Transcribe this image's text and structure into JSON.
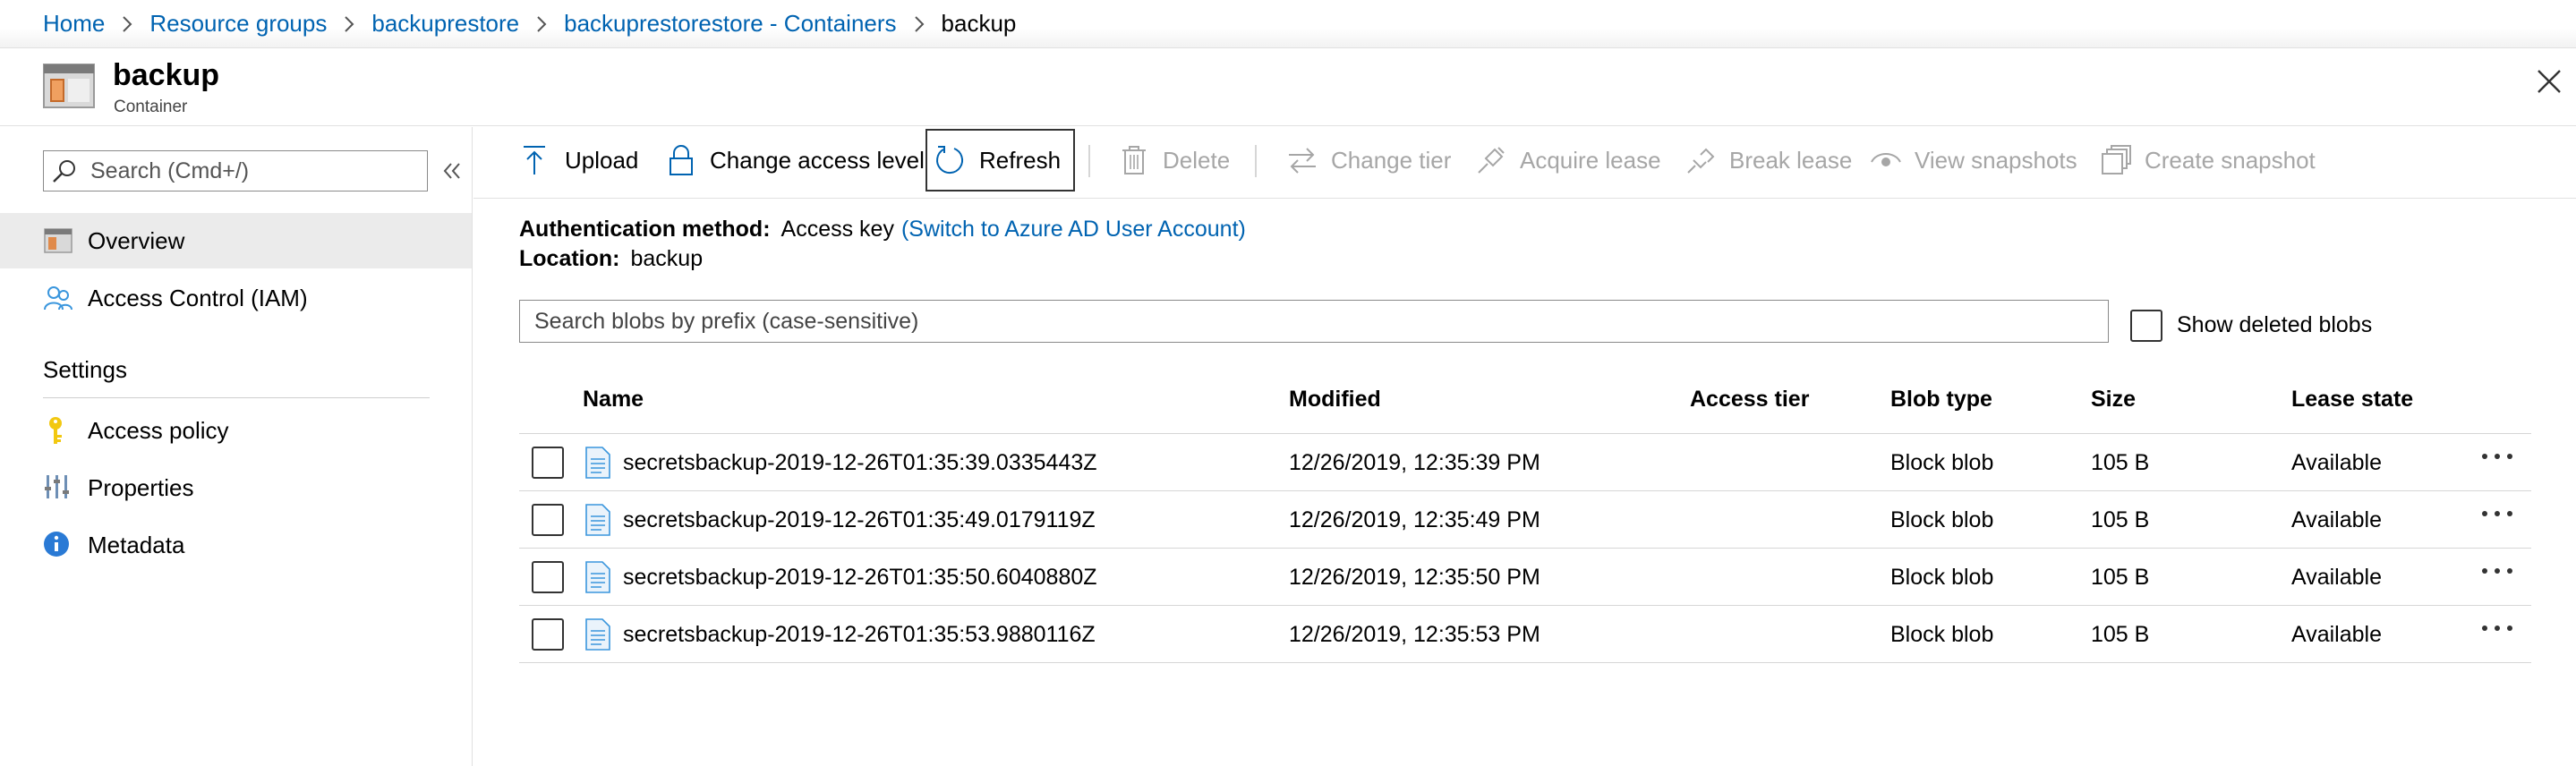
{
  "breadcrumb": [
    {
      "label": "Home"
    },
    {
      "label": "Resource groups"
    },
    {
      "label": "backuprestore"
    },
    {
      "label": "backuprestorestore - Containers"
    },
    {
      "label": "backup"
    }
  ],
  "header": {
    "title": "backup",
    "subtitle": "Container"
  },
  "sidebar": {
    "search_placeholder": "Search (Cmd+/)",
    "items": [
      {
        "label": "Overview",
        "icon": "container-icon",
        "active": true
      },
      {
        "label": "Access Control (IAM)",
        "icon": "people-icon"
      }
    ],
    "settings_heading": "Settings",
    "settings_items": [
      {
        "label": "Access policy",
        "icon": "key-icon"
      },
      {
        "label": "Properties",
        "icon": "properties-icon"
      },
      {
        "label": "Metadata",
        "icon": "info-icon"
      }
    ]
  },
  "toolbar": {
    "upload": "Upload",
    "change_access": "Change access level",
    "refresh": "Refresh",
    "delete": "Delete",
    "change_tier": "Change tier",
    "acquire_lease": "Acquire lease",
    "break_lease": "Break lease",
    "view_snapshots": "View snapshots",
    "create_snapshot": "Create snapshot"
  },
  "info": {
    "auth_label": "Authentication method:",
    "auth_value": "Access key",
    "auth_link": "(Switch to Azure AD User Account)",
    "location_label": "Location:",
    "location_value": "backup"
  },
  "blob_search": {
    "placeholder": "Search blobs by prefix (case-sensitive)"
  },
  "show_deleted_label": "Show deleted blobs",
  "table": {
    "columns": [
      "Name",
      "Modified",
      "Access tier",
      "Blob type",
      "Size",
      "Lease state"
    ],
    "rows": [
      {
        "name": "secretsbackup-2019-12-26T01:35:39.0335443Z",
        "modified": "12/26/2019, 12:35:39 PM",
        "access_tier": "",
        "blob_type": "Block blob",
        "size": "105 B",
        "lease_state": "Available"
      },
      {
        "name": "secretsbackup-2019-12-26T01:35:49.0179119Z",
        "modified": "12/26/2019, 12:35:49 PM",
        "access_tier": "",
        "blob_type": "Block blob",
        "size": "105 B",
        "lease_state": "Available"
      },
      {
        "name": "secretsbackup-2019-12-26T01:35:50.6040880Z",
        "modified": "12/26/2019, 12:35:50 PM",
        "access_tier": "",
        "blob_type": "Block blob",
        "size": "105 B",
        "lease_state": "Available"
      },
      {
        "name": "secretsbackup-2019-12-26T01:35:53.9880116Z",
        "modified": "12/26/2019, 12:35:53 PM",
        "access_tier": "",
        "blob_type": "Block blob",
        "size": "105 B",
        "lease_state": "Available"
      }
    ]
  },
  "colors": {
    "link": "#0063b1",
    "disabled": "#a6a6a6",
    "active_bg": "#ebebeb"
  }
}
